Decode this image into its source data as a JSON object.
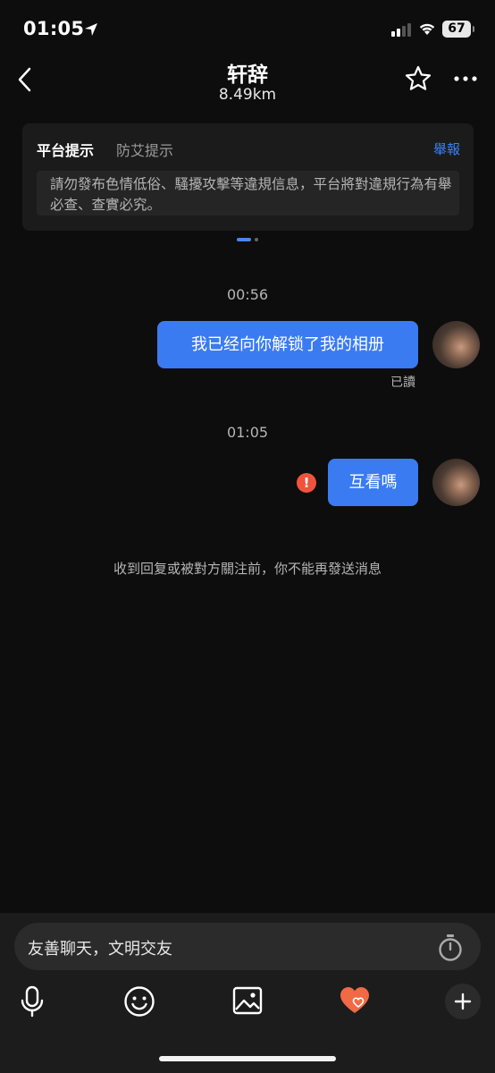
{
  "status_bar": {
    "time": "01:05",
    "battery": "67"
  },
  "header": {
    "title": "轩辞",
    "distance": "8.49km"
  },
  "notice": {
    "tab_platform": "平台提示",
    "tab_aids": "防艾提示",
    "report": "舉報",
    "text": "請勿發布色情低俗、騷擾攻擊等違規信息，平台將對違規行為有舉必查、查實必究。"
  },
  "chat": {
    "messages": [
      {
        "timestamp": "00:56",
        "text": "我已经向你解锁了我的相册",
        "status": "已讀"
      },
      {
        "timestamp": "01:05",
        "text": "互看嗎",
        "error_mark": "!"
      }
    ],
    "system_notice": "收到回复或被對方關注前，你不能再發送消息"
  },
  "input": {
    "placeholder": "友善聊天，文明交友"
  },
  "colors": {
    "accent": "#3a7bf2",
    "error": "#f0533d",
    "heart": "#f06a45"
  }
}
